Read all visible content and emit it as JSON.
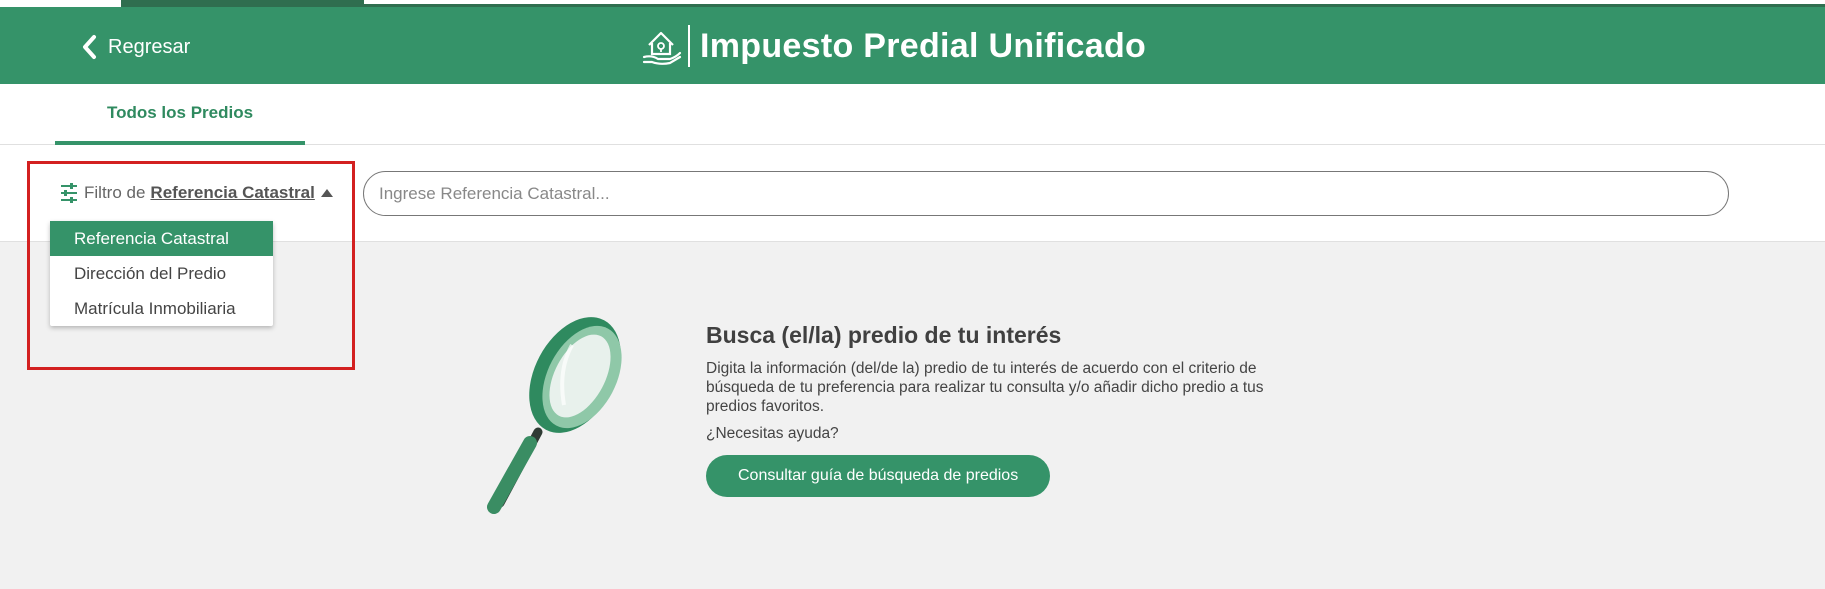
{
  "header": {
    "back_label": "Regresar",
    "title": "Impuesto Predial Unificado"
  },
  "tabs": [
    {
      "label": "Todos los Predios",
      "active": true
    }
  ],
  "filter": {
    "prefix": "Filtro de",
    "selected": "Referencia Catastral",
    "options": [
      "Referencia Catastral",
      "Dirección del Predio",
      "Matrícula Inmobiliaria"
    ]
  },
  "search": {
    "placeholder": "Ingrese Referencia Catastral...",
    "value": ""
  },
  "info": {
    "heading": "Busca (el/la) predio de tu interés",
    "description": "Digita la información (del/de la) predio de tu interés de acuerdo con el criterio de búsqueda de tu preferencia para realizar tu consulta y/o añadir dicho predio a tus predios favoritos.",
    "help": "¿Necesitas ayuda?",
    "button_label": "Consultar guía de búsqueda de predios"
  },
  "colors": {
    "primary": "#359369",
    "dark_green": "#2f6e4f",
    "highlight": "#d32020",
    "background": "#f1f1f1"
  }
}
